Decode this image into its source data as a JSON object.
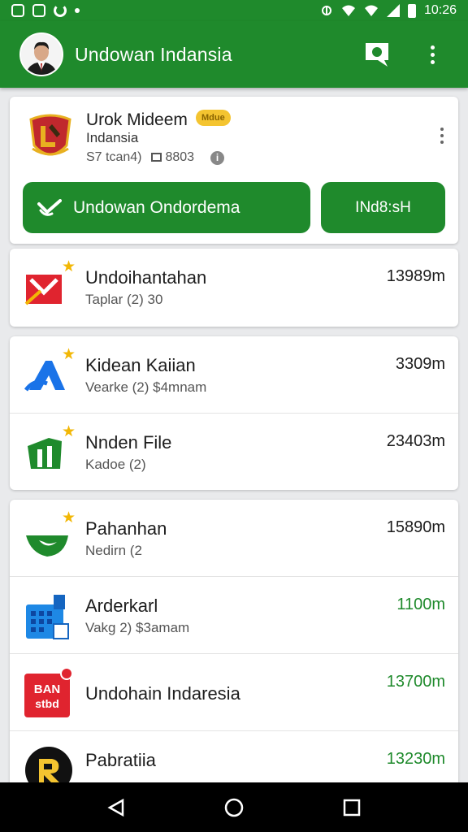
{
  "status_bar": {
    "time": "10:26"
  },
  "app_bar": {
    "title": "Undowan Indansia"
  },
  "featured": {
    "title": "Urok Mideem",
    "badge": "Mdue",
    "subtitle": "Indansia",
    "meta_left": "S7 tcan4)",
    "meta_right": "8803",
    "primary_button": "Undowan Ondordema",
    "secondary_button": "INd8:sH"
  },
  "rows": [
    {
      "title": "Undoihantahan",
      "subtitle": "Taplar (2) 30",
      "value": "13989m"
    },
    {
      "title": "Kidean Kaiian",
      "subtitle": "Vearke (2) $4mnam",
      "value": "3309m"
    },
    {
      "title": "Nnden File",
      "subtitle": "Kadoe (2)",
      "value": "23403m"
    },
    {
      "title": "Pahanhan",
      "subtitle": "Nedirn (2",
      "value": "15890m"
    },
    {
      "title": "Arderkarl",
      "subtitle": "Vakg 2) $3amam",
      "value": "1100m"
    },
    {
      "title": "Undohain Indaresia",
      "subtitle": "",
      "value": "13700m"
    },
    {
      "title": "Pabratiia",
      "subtitle": "",
      "value": "13230m"
    }
  ],
  "icons": {
    "row_0": "red-envelope-icon",
    "row_1": "blue-triangle-icon",
    "row_2": "green-file-icon",
    "row_3": "green-leaf-icon",
    "row_4": "blue-building-icon",
    "row_5": "red-ban-logo-icon",
    "row_6": "black-r-logo-icon"
  },
  "row_icon_text": {
    "ban": "BAN",
    "sticker": "stbd"
  },
  "colors": {
    "primary": "#1f8a2c",
    "star": "#f2b705",
    "badge": "#f4c430"
  }
}
